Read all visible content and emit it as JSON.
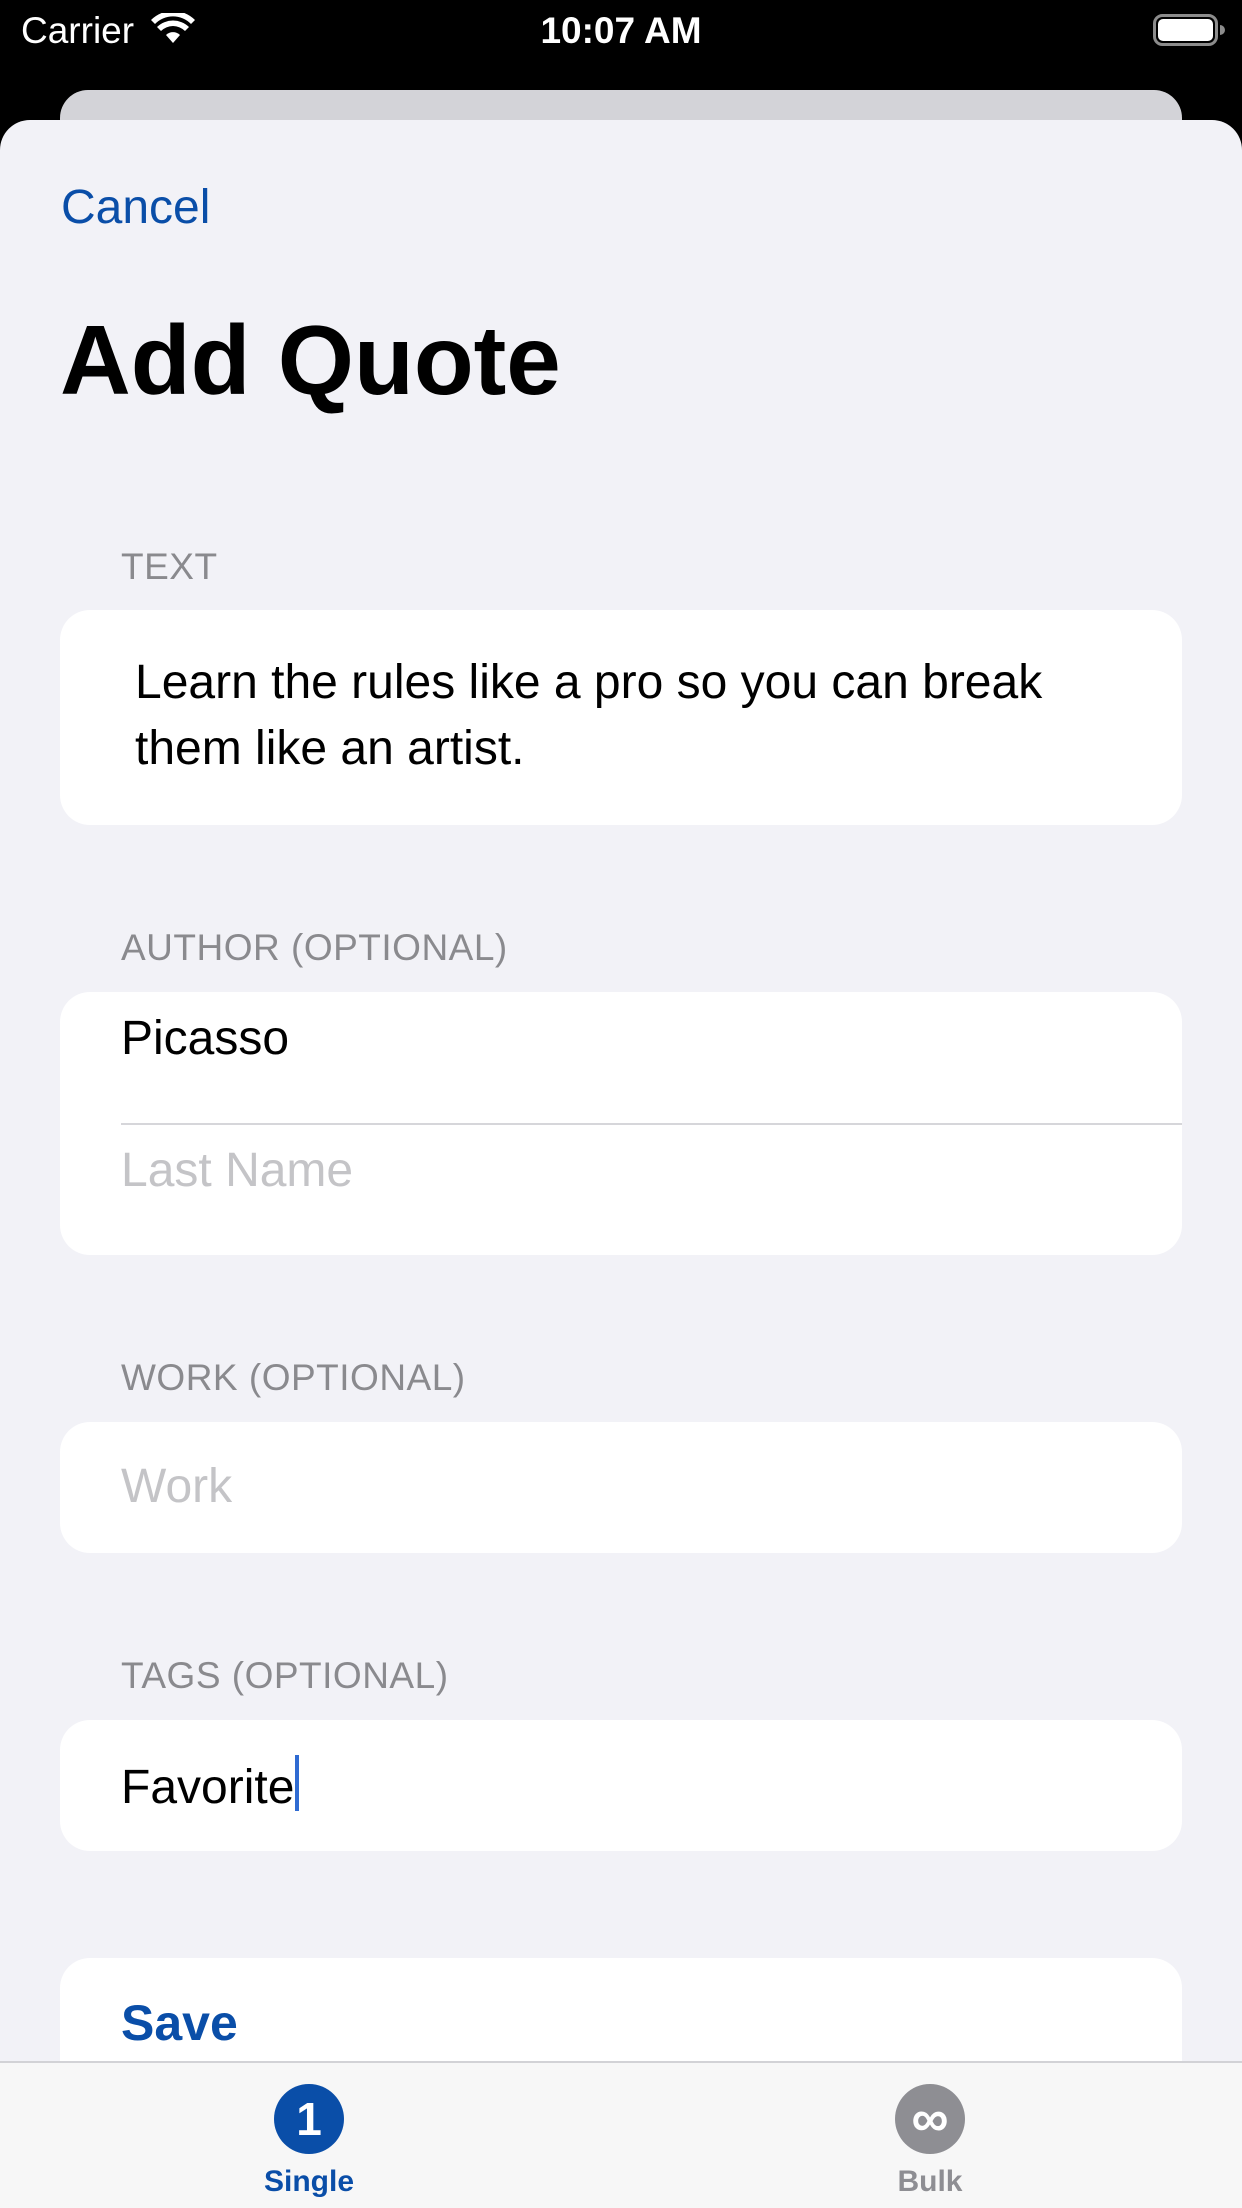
{
  "status_bar": {
    "carrier": "Carrier",
    "time": "10:07 AM"
  },
  "nav": {
    "cancel_label": "Cancel",
    "title": "Add Quote"
  },
  "form": {
    "text_section": {
      "header": "TEXT",
      "value": "Learn the rules like a pro so you can break them like an artist."
    },
    "author_section": {
      "header": "AUTHOR (OPTIONAL)",
      "first_name_value": "Picasso",
      "last_name_placeholder": "Last Name"
    },
    "work_section": {
      "header": "WORK (OPTIONAL)",
      "work_placeholder": "Work"
    },
    "tags_section": {
      "header": "TAGS (OPTIONAL)",
      "value": "Favorite"
    },
    "save_label": "Save"
  },
  "tab_bar": {
    "tabs": [
      {
        "label": "Single",
        "icon_glyph": "1",
        "icon": "number-one-circle-icon",
        "selected": true
      },
      {
        "label": "Bulk",
        "icon_glyph": "∞",
        "icon": "infinity-circle-icon",
        "selected": false
      }
    ]
  },
  "colors": {
    "accent": "#0a4ea8",
    "background": "#f2f2f7",
    "section_header": "#8a8a8e",
    "placeholder": "#c4c4c7",
    "tab_inactive": "#8e8e93"
  }
}
